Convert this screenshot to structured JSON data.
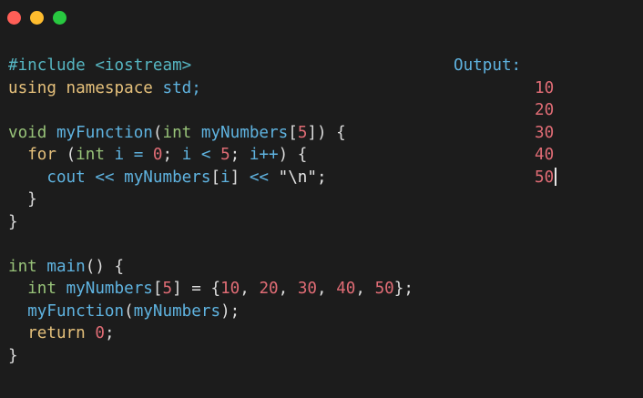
{
  "colors": {
    "background": "#1c1c1c",
    "close": "#ff5f57",
    "minimize": "#febc2e",
    "maximize": "#28c840",
    "preprocessor": "#56b6c2",
    "keyword": "#e5c07b",
    "function": "#5fb3e0",
    "type": "#98c379",
    "number": "#e06c75",
    "plain": "#dcdcdc",
    "operator": "#dcdcdc",
    "string": "#e6e6e6"
  },
  "code_lines": [
    [
      {
        "t": "#include <iostream>",
        "c": "preprocessor"
      }
    ],
    [
      {
        "t": "using namespace ",
        "c": "keyword"
      },
      {
        "t": "std;",
        "c": "function"
      }
    ],
    [],
    [
      {
        "t": "void ",
        "c": "type"
      },
      {
        "t": "myFunction",
        "c": "function"
      },
      {
        "t": "(",
        "c": "plain"
      },
      {
        "t": "int ",
        "c": "type"
      },
      {
        "t": "myNumbers",
        "c": "function"
      },
      {
        "t": "[",
        "c": "plain"
      },
      {
        "t": "5",
        "c": "number"
      },
      {
        "t": "]) {",
        "c": "plain"
      }
    ],
    [
      {
        "t": "  ",
        "c": "plain"
      },
      {
        "t": "for ",
        "c": "keyword"
      },
      {
        "t": "(",
        "c": "plain"
      },
      {
        "t": "int ",
        "c": "type"
      },
      {
        "t": "i = ",
        "c": "function"
      },
      {
        "t": "0",
        "c": "number"
      },
      {
        "t": "; ",
        "c": "plain"
      },
      {
        "t": "i < ",
        "c": "function"
      },
      {
        "t": "5",
        "c": "number"
      },
      {
        "t": "; ",
        "c": "plain"
      },
      {
        "t": "i++",
        "c": "function"
      },
      {
        "t": ") {",
        "c": "plain"
      }
    ],
    [
      {
        "t": "    ",
        "c": "plain"
      },
      {
        "t": "cout << myNumbers",
        "c": "function"
      },
      {
        "t": "[",
        "c": "plain"
      },
      {
        "t": "i",
        "c": "function"
      },
      {
        "t": "] ",
        "c": "plain"
      },
      {
        "t": "<< ",
        "c": "function"
      },
      {
        "t": "\"\\n\";",
        "c": "string"
      }
    ],
    [
      {
        "t": "  }",
        "c": "plain"
      }
    ],
    [
      {
        "t": "}",
        "c": "plain"
      }
    ],
    [],
    [
      {
        "t": "int ",
        "c": "type"
      },
      {
        "t": "main",
        "c": "function"
      },
      {
        "t": "() {",
        "c": "plain"
      }
    ],
    [
      {
        "t": "  ",
        "c": "plain"
      },
      {
        "t": "int ",
        "c": "type"
      },
      {
        "t": "myNumbers",
        "c": "function"
      },
      {
        "t": "[",
        "c": "plain"
      },
      {
        "t": "5",
        "c": "number"
      },
      {
        "t": "] = {",
        "c": "plain"
      },
      {
        "t": "10",
        "c": "number"
      },
      {
        "t": ", ",
        "c": "plain"
      },
      {
        "t": "20",
        "c": "number"
      },
      {
        "t": ", ",
        "c": "plain"
      },
      {
        "t": "30",
        "c": "number"
      },
      {
        "t": ", ",
        "c": "plain"
      },
      {
        "t": "40",
        "c": "number"
      },
      {
        "t": ", ",
        "c": "plain"
      },
      {
        "t": "50",
        "c": "number"
      },
      {
        "t": "};",
        "c": "plain"
      }
    ],
    [
      {
        "t": "  ",
        "c": "plain"
      },
      {
        "t": "myFunction",
        "c": "function"
      },
      {
        "t": "(",
        "c": "plain"
      },
      {
        "t": "myNumbers",
        "c": "function"
      },
      {
        "t": ");",
        "c": "plain"
      }
    ],
    [
      {
        "t": "  ",
        "c": "plain"
      },
      {
        "t": "return ",
        "c": "keyword"
      },
      {
        "t": "0",
        "c": "number"
      },
      {
        "t": ";",
        "c": "plain"
      }
    ],
    [
      {
        "t": "}",
        "c": "plain"
      }
    ]
  ],
  "output": {
    "label": "Output:",
    "values": [
      "10",
      "20",
      "30",
      "40",
      "50"
    ]
  }
}
